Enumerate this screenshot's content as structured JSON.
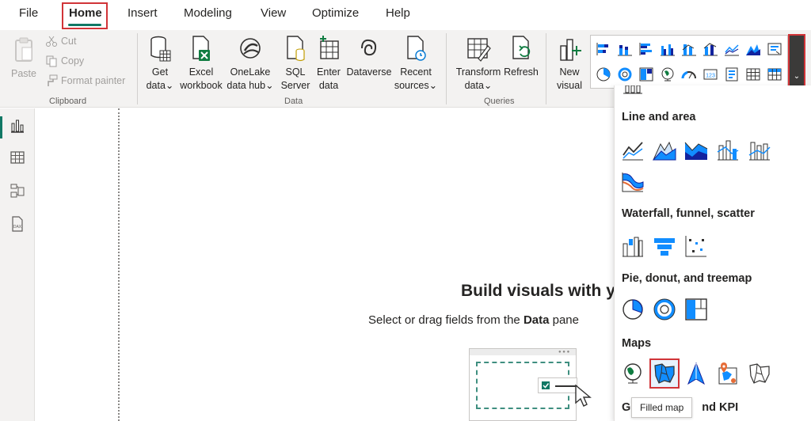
{
  "menu": {
    "file": "File",
    "home": "Home",
    "insert": "Insert",
    "modeling": "Modeling",
    "view": "View",
    "optimize": "Optimize",
    "help": "Help"
  },
  "ribbon": {
    "clipboard": {
      "paste": "Paste",
      "cut": "Cut",
      "copy": "Copy",
      "format_painter": "Format painter",
      "group": "Clipboard"
    },
    "data": {
      "get_data": [
        "Get",
        "data"
      ],
      "excel": [
        "Excel",
        "workbook"
      ],
      "onelake": [
        "OneLake",
        "data hub"
      ],
      "sql": [
        "SQL",
        "Server"
      ],
      "enter": [
        "Enter",
        "data"
      ],
      "dataverse": "Dataverse",
      "recent": [
        "Recent",
        "sources"
      ],
      "group": "Data"
    },
    "queries": {
      "transform": [
        "Transform",
        "data"
      ],
      "refresh": "Refresh",
      "group": "Queries"
    },
    "new_visual": [
      "New",
      "visual"
    ]
  },
  "canvas": {
    "title": "Build visuals with yo",
    "subtitle_pre": "Select or drag fields from the ",
    "subtitle_bold": "Data",
    "subtitle_post": " pane"
  },
  "panel": {
    "sections": {
      "line_area": "Line and area",
      "waterfall": "Waterfall, funnel, scatter",
      "pie": "Pie, donut, and treemap",
      "maps": "Maps",
      "kpi_partial": "G",
      "kpi_rest": "nd KPI"
    },
    "tooltip": "Filled map"
  },
  "colors": {
    "accent": "#117865",
    "highlight": "#d13438",
    "chart_blue": "#118dff",
    "chart_dark": "#12239e"
  }
}
